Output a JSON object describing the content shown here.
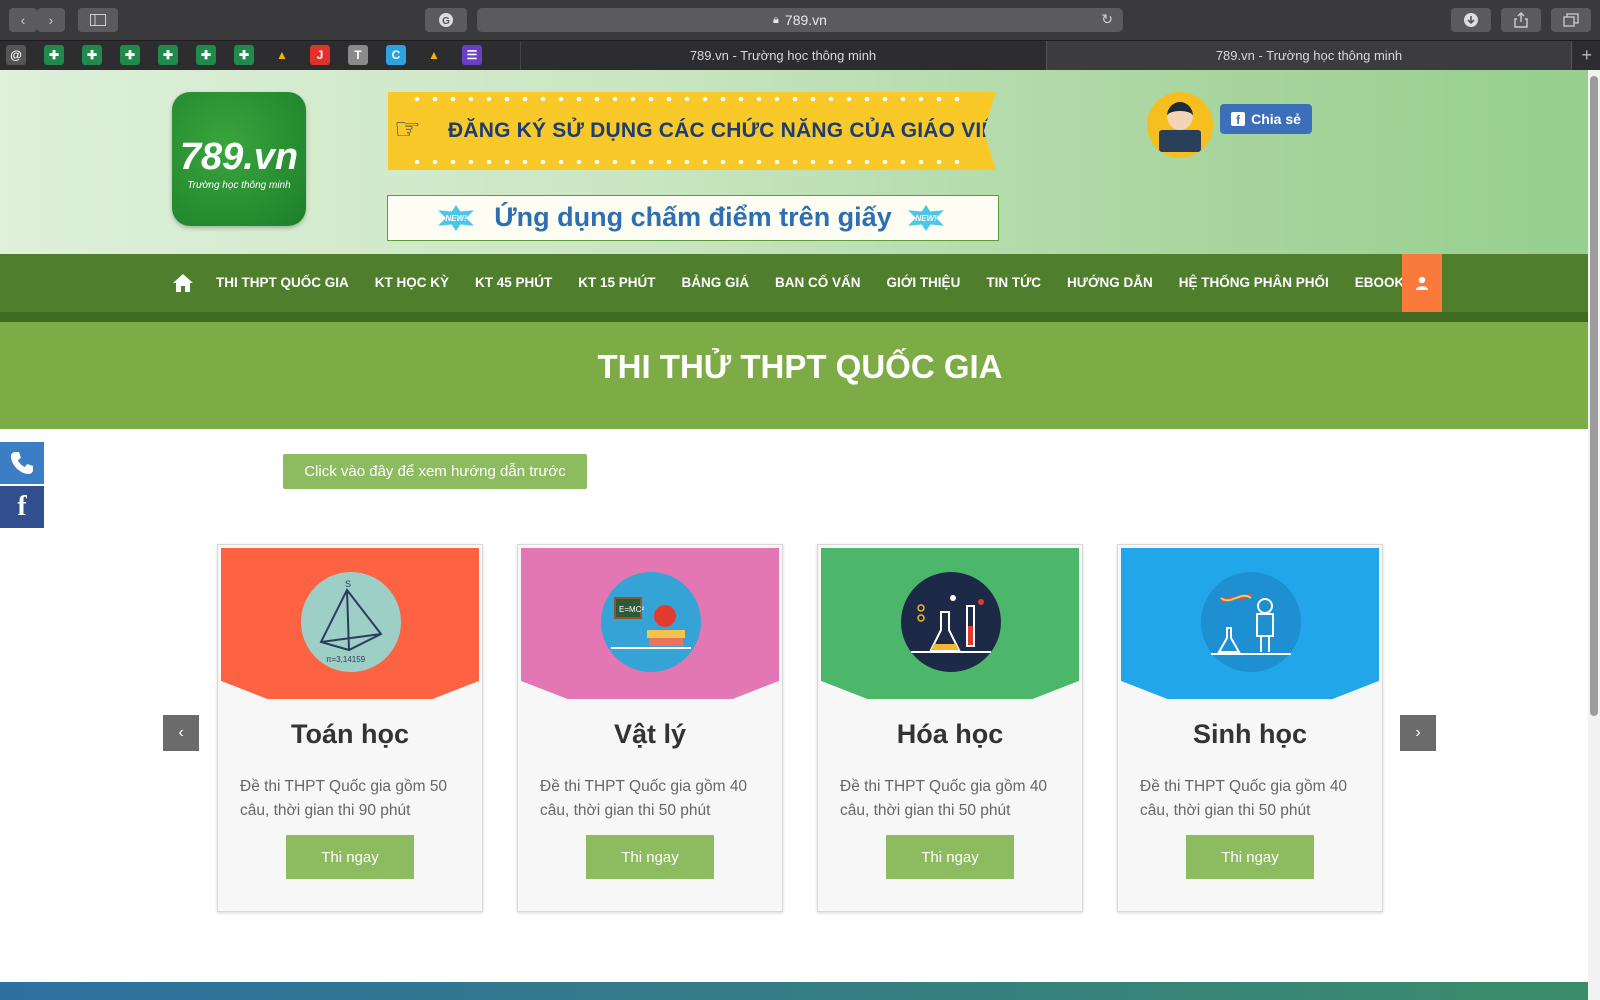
{
  "browser": {
    "url": "789.vn",
    "tabs": [
      {
        "title": "789.vn - Trường học thông minh",
        "active": false
      },
      {
        "title": "789.vn - Trường học thông minh",
        "active": true
      }
    ],
    "favorites": [
      {
        "icon": "at-icon",
        "glyph": "@",
        "color": "#555555"
      },
      {
        "icon": "plus-app-icon",
        "glyph": "✚",
        "color": "#1f8a4a"
      },
      {
        "icon": "plus-app-icon",
        "glyph": "✚",
        "color": "#1f8a4a"
      },
      {
        "icon": "plus-app-icon",
        "glyph": "✚",
        "color": "#1f8a4a"
      },
      {
        "icon": "plus-app-icon",
        "glyph": "✚",
        "color": "#1f8a4a"
      },
      {
        "icon": "plus-app-icon",
        "glyph": "✚",
        "color": "#1f8a4a"
      },
      {
        "icon": "plus-app-icon",
        "glyph": "✚",
        "color": "#1f8a4a"
      },
      {
        "icon": "google-drive-icon",
        "glyph": "▲",
        "color": "#2d2d2f"
      },
      {
        "icon": "j-app-icon",
        "glyph": "J",
        "color": "#e0322a"
      },
      {
        "icon": "t-app-icon",
        "glyph": "T",
        "color": "#8a8a8a"
      },
      {
        "icon": "c-app-icon",
        "glyph": "C",
        "color": "#2aa3e0"
      },
      {
        "icon": "google-drive-icon",
        "glyph": "▲",
        "color": "#2d2d2f"
      },
      {
        "icon": "list-app-icon",
        "glyph": "☰",
        "color": "#6a3fc8"
      }
    ]
  },
  "header": {
    "logo_text": "789.vn",
    "logo_sub": "Trường học thông minh",
    "banner_register": "ĐĂNG KÝ SỬ DỤNG CÁC CHỨC NĂNG CỦA GIÁO VIÊN",
    "banner_app": "Ứng dụng chấm điểm trên giấy",
    "new_badge": "NEW!",
    "share_label": "Chia sẻ"
  },
  "nav": {
    "items": [
      "THI THPT QUỐC GIA",
      "KT HỌC KỲ",
      "KT 45 PHÚT",
      "KT 15 PHÚT",
      "BẢNG GIÁ",
      "BAN CỐ VẤN",
      "GIỚI THIỆU",
      "TIN TỨC",
      "HƯỚNG DẪN",
      "HỆ THỐNG PHÂN PHỐI",
      "EBOOK"
    ]
  },
  "hero": {
    "title": "THI THỬ THPT QUỐC GIA"
  },
  "guide_button": "Click vào đây để xem hướng dẫn trước",
  "cards": [
    {
      "title": "Toán học",
      "desc": "Đề thi THPT Quốc gia gồm 50 câu, thời gian thi 90 phút",
      "button": "Thi ngay",
      "color": "#fd6343",
      "circle": "#9ecfc6",
      "icon": "pyramid-geometry-icon"
    },
    {
      "title": "Vật lý",
      "desc": "Đề thi THPT Quốc gia gồm 40 câu, thời gian thi 50 phút",
      "button": "Thi ngay",
      "color": "#e277b3",
      "circle": "#36a3d6",
      "icon": "physics-apple-icon"
    },
    {
      "title": "Hóa học",
      "desc": "Đề thi THPT Quốc gia gồm 40 câu, thời gian thi 50 phút",
      "button": "Thi ngay",
      "color": "#4cb76a",
      "circle": "#1c2a48",
      "icon": "chemistry-flask-icon"
    },
    {
      "title": "Sinh học",
      "desc": "Đề thi THPT Quốc gia gồm 40 câu, thời gian thi 50 phút",
      "button": "Thi ngay",
      "color": "#22a6ea",
      "circle": "#1e8fd0",
      "icon": "biology-dna-icon"
    }
  ],
  "colors": {
    "nav": "#4f7f2c",
    "hero": "#7dab45",
    "button": "#8dbb5f",
    "user_button": "#fa7a3c"
  }
}
